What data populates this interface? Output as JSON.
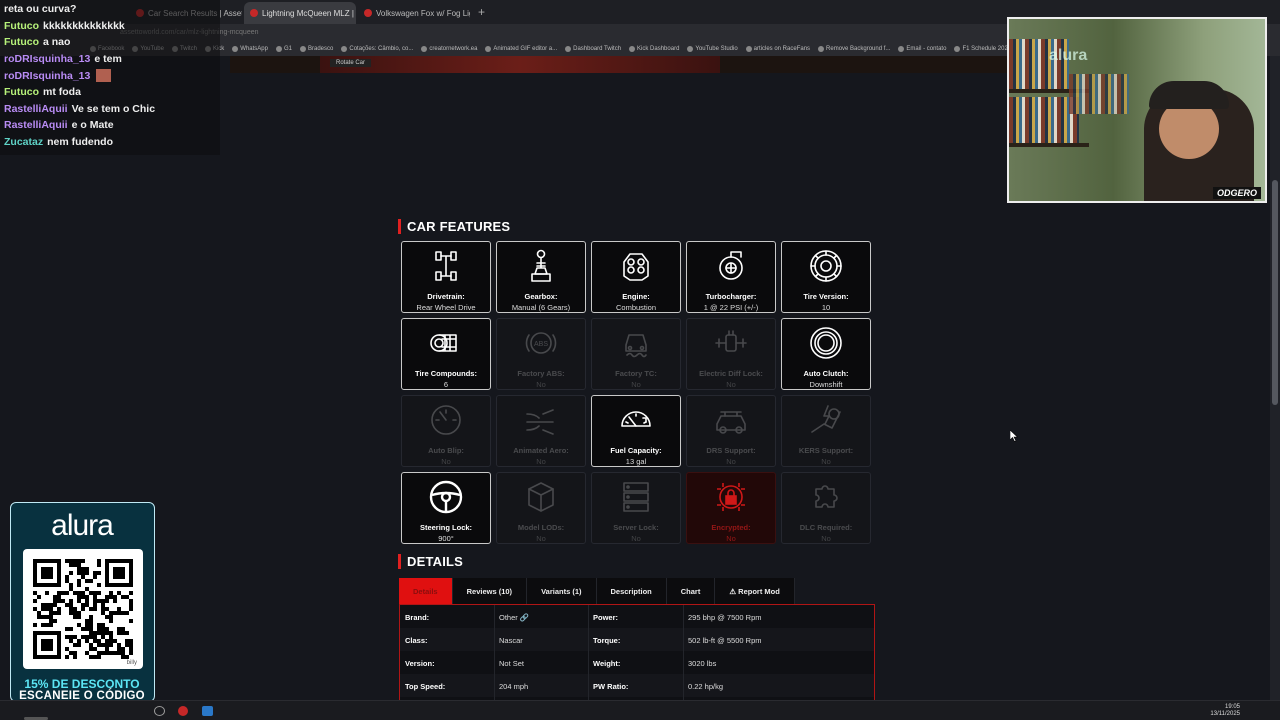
{
  "browser": {
    "tabs": [
      {
        "label": "Car Search Results | Assetto Wo",
        "active": false
      },
      {
        "label": "Lightning McQueen MLZ | Car",
        "active": true
      },
      {
        "label": "Volkswagen Fox w/ Fog Lights |",
        "active": false
      }
    ],
    "new_tab": "+",
    "close": "×",
    "url": "assettoworld.com/car/mlz-lightning-mcqueen",
    "bookmarks": [
      "Facebook",
      "YouTube",
      "Twitch",
      "Kick",
      "WhatsApp",
      "G1",
      "Bradesco",
      "Cotações: Câmbio, co...",
      "creatornetwork.ea",
      "Animated GIF editor a...",
      "Dashboard Twitch",
      "Kick Dashboard",
      "YouTube Studio",
      "articles on RaceFans",
      "Remove Background f...",
      "Email - contato",
      "F1 Schedule 2025 - Of...",
      "NFS-e | Portal Contr"
    ]
  },
  "page_strip": {
    "rotate_car": "Rotate Car"
  },
  "chat": [
    {
      "user": "",
      "msg": "reta ou curva?",
      "color": "#ffffff"
    },
    {
      "user": "Futuco",
      "msg": "kkkkkkkkkkkkkk",
      "color": "#b7f27a"
    },
    {
      "user": "Futuco",
      "msg": "a nao",
      "color": "#b7f27a"
    },
    {
      "user": "roDRIsquinha_13",
      "msg": "e tem",
      "color": "#b98cf5"
    },
    {
      "user": "roDRIsquinha_13",
      "msg": "",
      "color": "#b98cf5",
      "emote": true
    },
    {
      "user": "Futuco",
      "msg": "mt foda",
      "color": "#b7f27a"
    },
    {
      "user": "RastelliAquii",
      "msg": "Ve se tem o Chic",
      "color": "#b98cf5"
    },
    {
      "user": "RastelliAquii",
      "msg": "e o Mate",
      "color": "#b98cf5"
    },
    {
      "user": "Zucataz",
      "msg": "nem fudendo",
      "color": "#5fd3c7"
    }
  ],
  "webcam": {
    "watermark": "alura",
    "label": "ODGERO"
  },
  "sections": {
    "features": "CAR FEATURES",
    "details": "DETAILS"
  },
  "features": [
    {
      "icon": "drivetrain-icon",
      "title": "Drivetrain:",
      "value": "Rear Wheel Drive",
      "state": "on"
    },
    {
      "icon": "gearbox-icon",
      "title": "Gearbox:",
      "value": "Manual (6 Gears)",
      "state": "on"
    },
    {
      "icon": "engine-icon",
      "title": "Engine:",
      "value": "Combustion",
      "state": "on"
    },
    {
      "icon": "turbocharger-icon",
      "title": "Turbocharger:",
      "value": "1 @ 22 PSI (+/-)",
      "state": "on"
    },
    {
      "icon": "tire-icon",
      "title": "Tire Version:",
      "value": "10",
      "state": "on"
    },
    {
      "icon": "tire-compounds-icon",
      "title": "Tire Compounds:",
      "value": "6",
      "state": "on"
    },
    {
      "icon": "abs-icon",
      "title": "Factory ABS:",
      "value": "No",
      "state": "off"
    },
    {
      "icon": "traction-control-icon",
      "title": "Factory TC:",
      "value": "No",
      "state": "off"
    },
    {
      "icon": "diff-lock-icon",
      "title": "Electric Diff Lock:",
      "value": "No",
      "state": "off"
    },
    {
      "icon": "clutch-icon",
      "title": "Auto Clutch:",
      "value": "Downshift",
      "state": "on"
    },
    {
      "icon": "auto-blip-icon",
      "title": "Auto Blip:",
      "value": "No",
      "state": "off"
    },
    {
      "icon": "aero-icon",
      "title": "Animated Aero:",
      "value": "No",
      "state": "off"
    },
    {
      "icon": "fuel-gauge-icon",
      "title": "Fuel Capacity:",
      "value": "13 gal",
      "state": "on"
    },
    {
      "icon": "drs-icon",
      "title": "DRS Support:",
      "value": "No",
      "state": "off"
    },
    {
      "icon": "kers-icon",
      "title": "KERS Support:",
      "value": "No",
      "state": "off"
    },
    {
      "icon": "steering-wheel-icon",
      "title": "Steering Lock:",
      "value": "900°",
      "state": "on"
    },
    {
      "icon": "model-lods-icon",
      "title": "Model LODs:",
      "value": "No",
      "state": "off"
    },
    {
      "icon": "server-icon",
      "title": "Server Lock:",
      "value": "No",
      "state": "off"
    },
    {
      "icon": "encrypted-icon",
      "title": "Encrypted:",
      "value": "No",
      "state": "red"
    },
    {
      "icon": "dlc-puzzle-icon",
      "title": "DLC Required:",
      "value": "No",
      "state": "off"
    }
  ],
  "detail_tabs": [
    "Details",
    "Reviews (10)",
    "Variants (1)",
    "Description",
    "Chart",
    "⚠ Report Mod"
  ],
  "details": [
    {
      "k1": "Brand:",
      "v1": "Other 🔗",
      "k2": "Power:",
      "v2": "295 bhp @ 7500 Rpm"
    },
    {
      "k1": "Class:",
      "v1": "Nascar",
      "k2": "Torque:",
      "v2": "502 lb-ft @ 5500 Rpm"
    },
    {
      "k1": "Version:",
      "v1": "Not Set",
      "k2": "Weight:",
      "v2": "3020 lbs"
    },
    {
      "k1": "Top Speed:",
      "v1": "204 mph",
      "k2": "PW Ratio:",
      "v2": "0.22 hp/kg"
    }
  ],
  "alura_ad": {
    "logo": "alura",
    "qr_tag": "billy",
    "promo_line1": "15% DE DESCONTO",
    "promo_line2": "ESCANEIE O CÓDIGO"
  },
  "taskbar": {
    "time": "19:05",
    "date": "13/11/2025"
  }
}
